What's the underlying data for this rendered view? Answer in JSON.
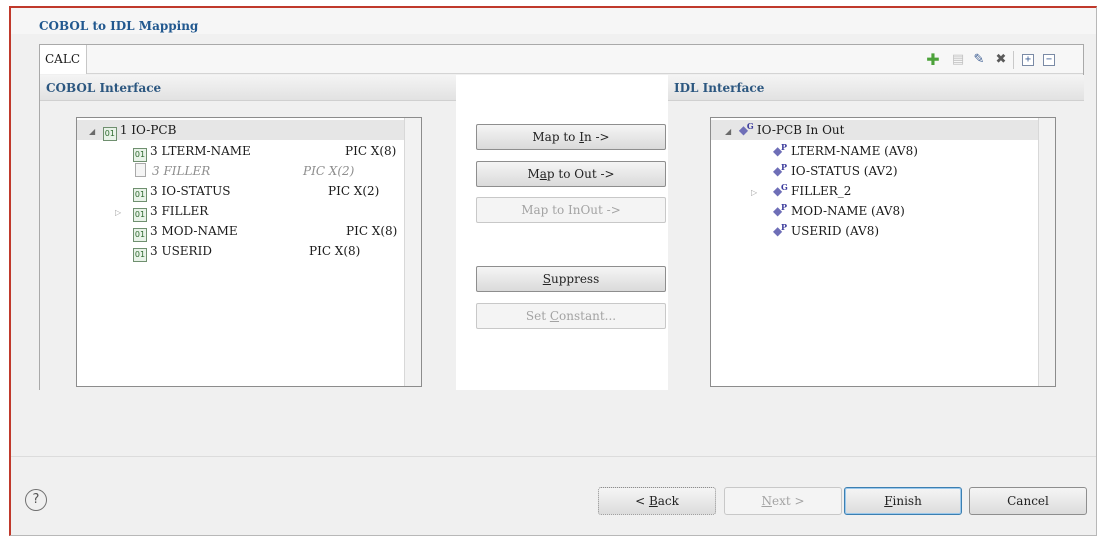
{
  "dialog": {
    "title": "COBOL to IDL Mapping"
  },
  "program_tab": {
    "label": "CALC"
  },
  "toolbar": {
    "icons": [
      "add-icon",
      "copy-icon",
      "rename-icon",
      "delete-icon",
      "expand-all-icon",
      "collapse-all-icon"
    ],
    "add_glyph": "✚",
    "copy_glyph": "▤",
    "rename_glyph": "✎",
    "delete_glyph": "✖",
    "expand_glyph": "+",
    "collapse_glyph": "−"
  },
  "cobol_interface": {
    "header": "COBOL Interface",
    "root": {
      "label": "1 IO-PCB"
    },
    "rows": [
      {
        "name": "3 LTERM-NAME",
        "pic": "PIC X(8)",
        "disabled": false,
        "expandable": false
      },
      {
        "name": "3 FILLER",
        "pic": "PIC X(2)",
        "disabled": true,
        "expandable": false
      },
      {
        "name": "3 IO-STATUS",
        "pic": "PIC X(2)",
        "disabled": false,
        "expandable": false
      },
      {
        "name": "3 FILLER",
        "pic": "",
        "disabled": false,
        "expandable": true
      },
      {
        "name": "3 MOD-NAME",
        "pic": "PIC X(8)",
        "disabled": false,
        "expandable": false
      },
      {
        "name": "3 USERID",
        "pic": "PIC X(8)",
        "disabled": false,
        "expandable": false
      }
    ]
  },
  "mapping_buttons": {
    "map_to_in_prefix": "Map to ",
    "map_to_in_key": "I",
    "map_to_in_suffix": "n ->",
    "map_to_out_prefix": "M",
    "map_to_out_key": "a",
    "map_to_out_suffix": "p to Out ->",
    "map_to_inout": "Map to InOut ->",
    "suppress_key": "S",
    "suppress_suffix": "uppress",
    "set_constant_prefix": "Set ",
    "set_constant_key": "C",
    "set_constant_suffix": "onstant..."
  },
  "idl_interface": {
    "header": "IDL Interface",
    "root": {
      "label": "IO-PCB  In Out",
      "badge": "G"
    },
    "rows": [
      {
        "label": "LTERM-NAME  (AV8)",
        "badge": "P",
        "expandable": false
      },
      {
        "label": "IO-STATUS  (AV2)",
        "badge": "P",
        "expandable": false
      },
      {
        "label": "FILLER_2",
        "badge": "G",
        "expandable": true
      },
      {
        "label": "MOD-NAME  (AV8)",
        "badge": "P",
        "expandable": false
      },
      {
        "label": "USERID  (AV8)",
        "badge": "P",
        "expandable": false
      }
    ]
  },
  "footer": {
    "help": "?",
    "back_prefix": "< ",
    "back_key": "B",
    "back_suffix": "ack",
    "next_key": "N",
    "next_suffix": "ext >",
    "finish_key": "F",
    "finish_suffix": "inish",
    "cancel": "Cancel"
  },
  "colors": {
    "accent_border": "#c0392b",
    "title_blue": "#21588f",
    "add_green": "#4ca23a"
  }
}
